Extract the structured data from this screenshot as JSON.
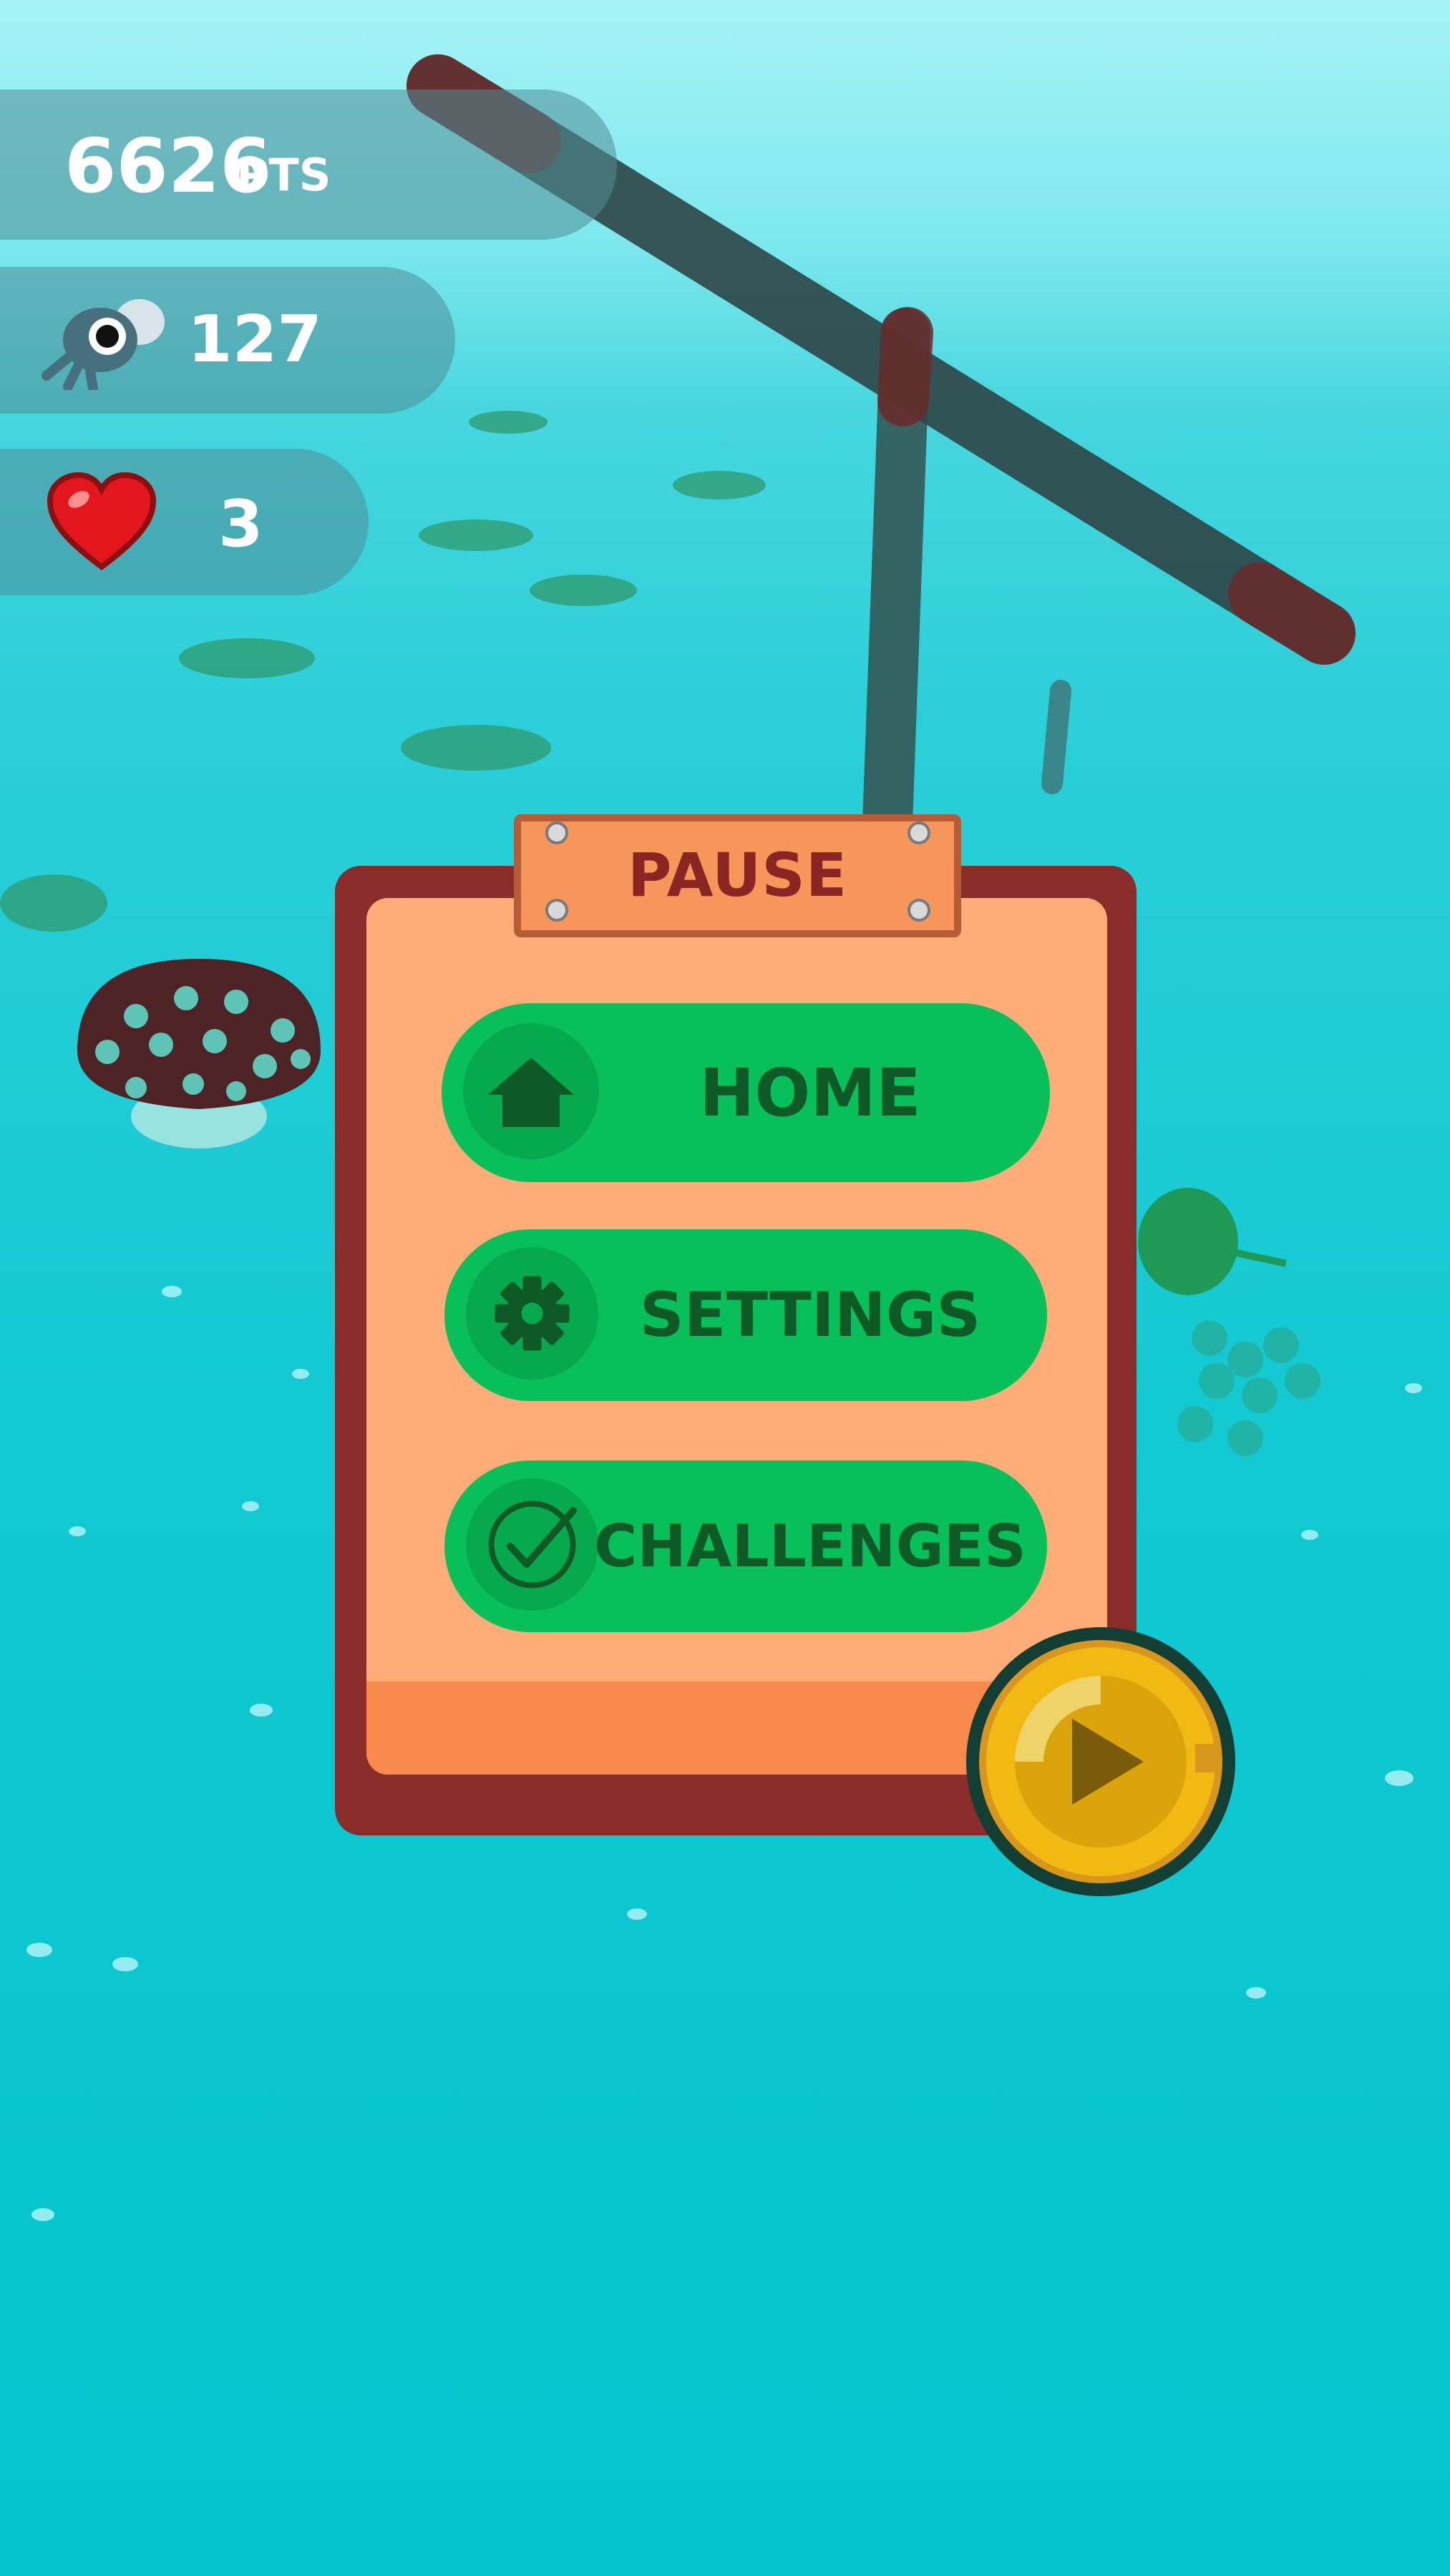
{
  "hud": {
    "score_value": "6626",
    "score_unit": "PTS",
    "flies_count": "127",
    "lives_count": "3"
  },
  "pause_menu": {
    "title": "PAUSE",
    "buttons": [
      {
        "label": "HOME",
        "icon": "home-icon"
      },
      {
        "label": "SETTINGS",
        "icon": "gear-icon"
      },
      {
        "label": "CHALLENGES",
        "icon": "checkmark-circle-icon"
      }
    ],
    "resume_icon": "play-icon"
  },
  "colors": {
    "panel_border": "#8a2c2a",
    "panel_fill": "#ffad78",
    "button_green": "#08c05a",
    "button_text": "#0d5a26",
    "title_text": "#8b2523",
    "resume_gold": "#e3aa0b"
  }
}
